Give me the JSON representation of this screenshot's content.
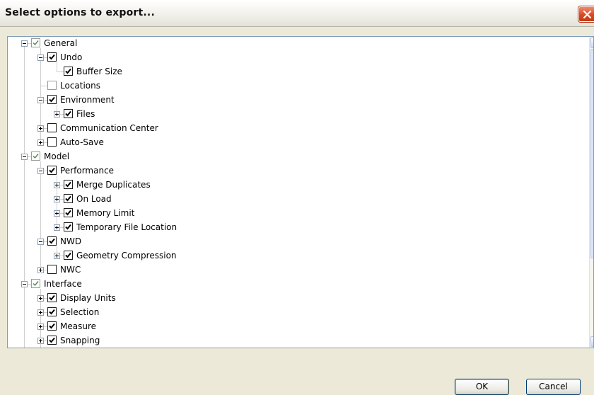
{
  "dialog": {
    "title": "Select options to export...",
    "ok_label": "OK",
    "cancel_label": "Cancel",
    "close_icon": "close-icon"
  },
  "tree": [
    {
      "label": "General",
      "level": 0,
      "expander": "minus",
      "checked": true,
      "faded": true
    },
    {
      "label": "Undo",
      "level": 1,
      "expander": "minus",
      "checked": true,
      "faded": false
    },
    {
      "label": "Buffer Size",
      "level": 2,
      "expander": "none",
      "checked": true,
      "faded": false
    },
    {
      "label": "Locations",
      "level": 1,
      "expander": "none",
      "checked": false,
      "faded": true
    },
    {
      "label": "Environment",
      "level": 1,
      "expander": "minus",
      "checked": true,
      "faded": false
    },
    {
      "label": "Files",
      "level": 2,
      "expander": "plus",
      "checked": true,
      "faded": false
    },
    {
      "label": "Communication Center",
      "level": 1,
      "expander": "plus",
      "checked": false,
      "faded": false
    },
    {
      "label": "Auto-Save",
      "level": 1,
      "expander": "plus",
      "checked": false,
      "faded": false
    },
    {
      "label": "Model",
      "level": 0,
      "expander": "minus",
      "checked": true,
      "faded": true
    },
    {
      "label": "Performance",
      "level": 1,
      "expander": "minus",
      "checked": true,
      "faded": false
    },
    {
      "label": "Merge Duplicates",
      "level": 2,
      "expander": "plus",
      "checked": true,
      "faded": false
    },
    {
      "label": "On Load",
      "level": 2,
      "expander": "plus",
      "checked": true,
      "faded": false
    },
    {
      "label": "Memory Limit",
      "level": 2,
      "expander": "plus",
      "checked": true,
      "faded": false
    },
    {
      "label": "Temporary File Location",
      "level": 2,
      "expander": "plus",
      "checked": true,
      "faded": false
    },
    {
      "label": "NWD",
      "level": 1,
      "expander": "minus",
      "checked": true,
      "faded": false
    },
    {
      "label": "Geometry Compression",
      "level": 2,
      "expander": "plus",
      "checked": true,
      "faded": false
    },
    {
      "label": "NWC",
      "level": 1,
      "expander": "plus",
      "checked": false,
      "faded": false
    },
    {
      "label": "Interface",
      "level": 0,
      "expander": "minus",
      "checked": true,
      "faded": true
    },
    {
      "label": "Display Units",
      "level": 1,
      "expander": "plus",
      "checked": true,
      "faded": false
    },
    {
      "label": "Selection",
      "level": 1,
      "expander": "plus",
      "checked": true,
      "faded": false
    },
    {
      "label": "Measure",
      "level": 1,
      "expander": "plus",
      "checked": true,
      "faded": false
    },
    {
      "label": "Snapping",
      "level": 1,
      "expander": "plus",
      "checked": true,
      "faded": false
    }
  ],
  "scrollbar": {
    "up_icon": "chevron-up-icon",
    "down_icon": "chevron-down-icon"
  },
  "colors": {
    "frame_border": "#7f9db9",
    "window_bg": "#ece9d8",
    "close_red": "#d94a22",
    "ok_focus": "#f4c66a"
  }
}
